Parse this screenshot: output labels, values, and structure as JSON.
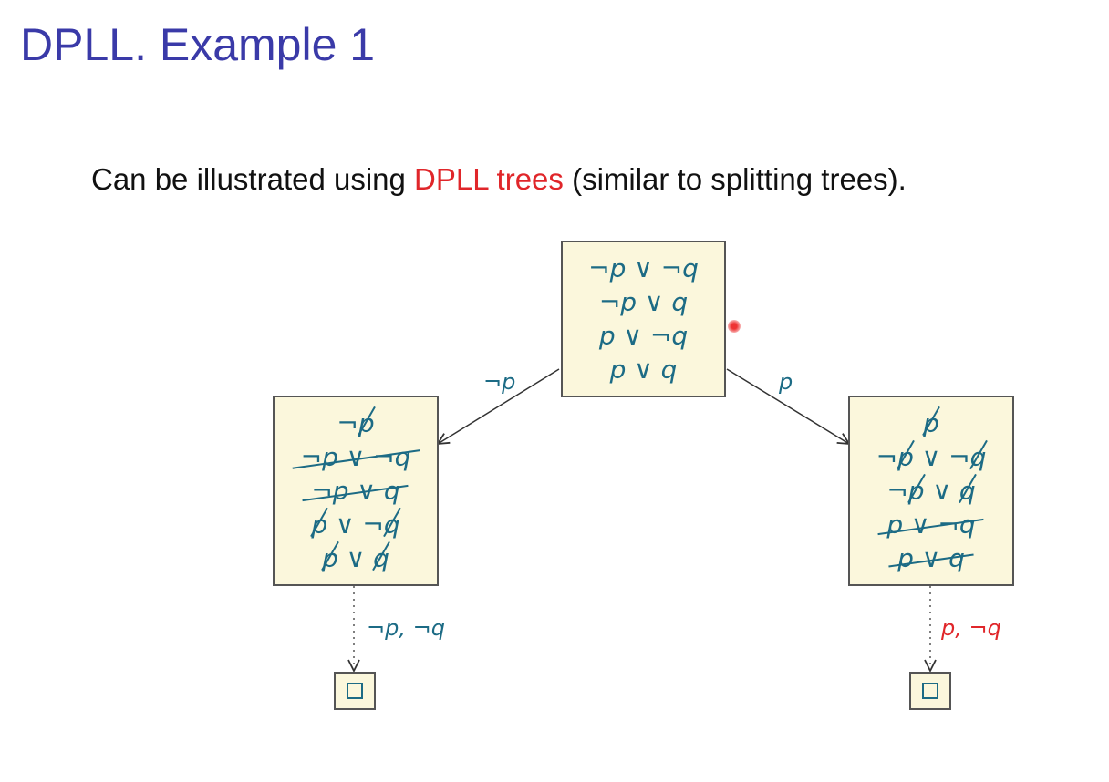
{
  "title": "DPLL. Example 1",
  "subtitle": {
    "before": "Can be illustrated using ",
    "highlight": "DPLL trees",
    "after": " (similar to splitting trees)."
  },
  "colors": {
    "title": "#3a3aa8",
    "highlight": "#e0262a",
    "formula": "#1c6b85",
    "node_fill": "#fbf7dc"
  },
  "tree": {
    "root": {
      "clauses": [
        {
          "strike": false,
          "tokens": [
            {
              "t": "¬p"
            },
            {
              "t": " ∨ ",
              "op": true
            },
            {
              "t": "¬q"
            }
          ]
        },
        {
          "strike": false,
          "tokens": [
            {
              "t": "¬p"
            },
            {
              "t": " ∨ ",
              "op": true
            },
            {
              "t": "q"
            }
          ]
        },
        {
          "strike": false,
          "tokens": [
            {
              "t": "p"
            },
            {
              "t": " ∨ ",
              "op": true
            },
            {
              "t": "¬q"
            }
          ]
        },
        {
          "strike": false,
          "tokens": [
            {
              "t": "p"
            },
            {
              "t": " ∨ ",
              "op": true
            },
            {
              "t": "q"
            }
          ]
        }
      ]
    },
    "left": {
      "edge_label": "¬p",
      "clauses": [
        {
          "strike": false,
          "tokens": [
            {
              "t": "¬",
              "op": true
            },
            {
              "t": "p",
              "slash": true
            }
          ]
        },
        {
          "strike": true,
          "tokens": [
            {
              "t": "¬p"
            },
            {
              "t": " ∨ ",
              "op": true
            },
            {
              "t": "¬q"
            }
          ]
        },
        {
          "strike": true,
          "tokens": [
            {
              "t": "¬p"
            },
            {
              "t": " ∨ ",
              "op": true
            },
            {
              "t": "q"
            }
          ]
        },
        {
          "strike": false,
          "tokens": [
            {
              "t": "p",
              "slash": true
            },
            {
              "t": " ∨ ¬",
              "op": true
            },
            {
              "t": "q",
              "slash": true
            }
          ]
        },
        {
          "strike": false,
          "tokens": [
            {
              "t": "p",
              "slash": true
            },
            {
              "t": " ∨ ",
              "op": true
            },
            {
              "t": "q",
              "slash": true
            }
          ]
        }
      ],
      "leaf_label": "¬p, ¬q",
      "leaf_color": "#1c6b85"
    },
    "right": {
      "edge_label": "p",
      "clauses": [
        {
          "strike": false,
          "tokens": [
            {
              "t": "p",
              "slash": true
            }
          ]
        },
        {
          "strike": false,
          "tokens": [
            {
              "t": "¬",
              "op": true
            },
            {
              "t": "p",
              "slash": true
            },
            {
              "t": " ∨ ¬",
              "op": true
            },
            {
              "t": "q",
              "slash": true
            }
          ]
        },
        {
          "strike": false,
          "tokens": [
            {
              "t": "¬",
              "op": true
            },
            {
              "t": "p",
              "slash": true
            },
            {
              "t": " ∨ ",
              "op": true
            },
            {
              "t": "q",
              "slash": true
            }
          ]
        },
        {
          "strike": true,
          "tokens": [
            {
              "t": "p"
            },
            {
              "t": " ∨ ",
              "op": true
            },
            {
              "t": "¬q"
            }
          ]
        },
        {
          "strike": true,
          "tokens": [
            {
              "t": "p"
            },
            {
              "t": " ∨ ",
              "op": true
            },
            {
              "t": "q"
            }
          ]
        }
      ],
      "leaf_label": "p, ¬q",
      "leaf_color": "#e0262a"
    }
  }
}
